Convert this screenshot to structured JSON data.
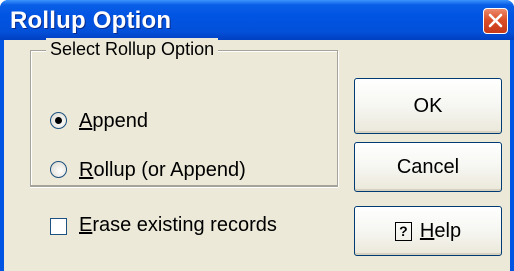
{
  "window": {
    "title": "Rollup Option",
    "close_icon": "close-icon"
  },
  "group": {
    "legend": "Select Rollup Option",
    "options": [
      {
        "prefix": "",
        "key": "A",
        "rest": "ppend",
        "selected": true
      },
      {
        "prefix": "",
        "key": "R",
        "rest": "ollup (or Append)",
        "selected": false
      }
    ]
  },
  "checkbox": {
    "key": "E",
    "rest": "rase existing records",
    "checked": false
  },
  "buttons": {
    "ok": "OK",
    "cancel": "Cancel",
    "help_icon": "help-icon",
    "help_key": "H",
    "help_rest": "elp"
  },
  "colors": {
    "titlebar": "#0054e3",
    "dialog_bg": "#ece9d8",
    "close_button": "#db4f28"
  }
}
